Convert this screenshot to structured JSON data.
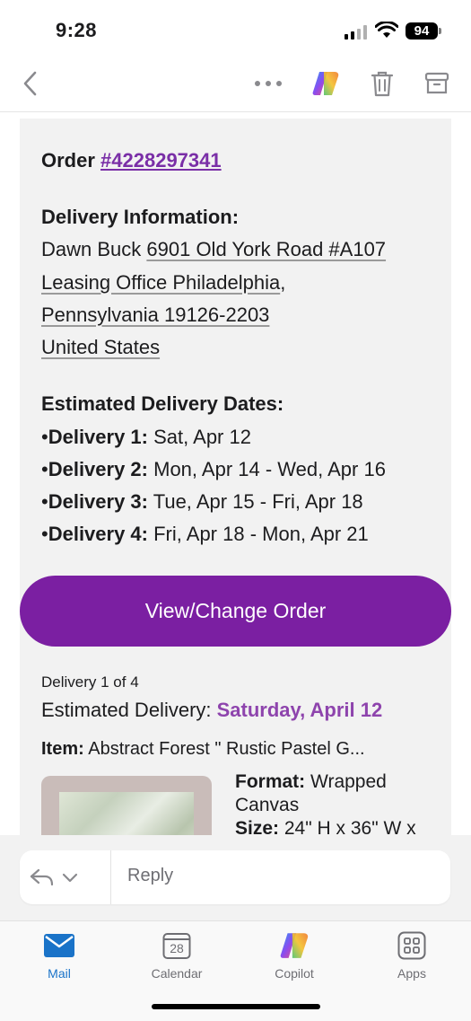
{
  "status": {
    "time": "9:28",
    "battery": "94"
  },
  "nav": {
    "icons": [
      "back-icon",
      "more-icon",
      "copilot-icon",
      "trash-icon",
      "archive-icon"
    ]
  },
  "email": {
    "order_prefix": "Order ",
    "order_number": "#4228297341",
    "delivery_info_heading": "Delivery Information:",
    "address_name": "Dawn Buck ",
    "address_line1": "6901 Old York Road #A107",
    "address_line2": "Leasing Office Philadelphia",
    "address_line2_suffix": ",",
    "address_line3": "Pennsylvania 19126-2203",
    "address_line4": "United States",
    "est_dates_heading": "Estimated Delivery Dates:",
    "deliveries": [
      {
        "bullet": "•",
        "label": "Delivery 1:",
        "date": " Sat, Apr 12"
      },
      {
        "bullet": "•",
        "label": "Delivery 2:",
        "date": " Mon, Apr 14 - Wed, Apr 16"
      },
      {
        "bullet": "•",
        "label": "Delivery 3:",
        "date": " Tue, Apr 15 - Fri, Apr 18"
      },
      {
        "bullet": "•",
        "label": "Delivery 4:",
        "date": " Fri, Apr 18 - Mon, Apr 21"
      }
    ],
    "cta_label": "View/Change Order",
    "delivery_count": "Delivery 1 of 4",
    "estimated_delivery_label": "Estimated Delivery: ",
    "estimated_delivery_date": "Saturday, April 12",
    "item_label": "Item:",
    "item_value": " Abstract Forest \" Rustic Pastel G...",
    "format_label": "Format:",
    "format_value": " Wrapped",
    "format_value_line2": "Canvas",
    "size_label": "Size:",
    "size_value": " 24\" H x 36\" W x"
  },
  "reply": {
    "placeholder": "Reply"
  },
  "tabs": [
    {
      "label": "Mail",
      "active": true
    },
    {
      "label": "Calendar",
      "day": "28"
    },
    {
      "label": "Copilot"
    },
    {
      "label": "Apps"
    }
  ],
  "colors": {
    "accent_purple": "#7b1fa2",
    "link_purple": "#7a2fa7",
    "mail_blue": "#1a73c8"
  }
}
